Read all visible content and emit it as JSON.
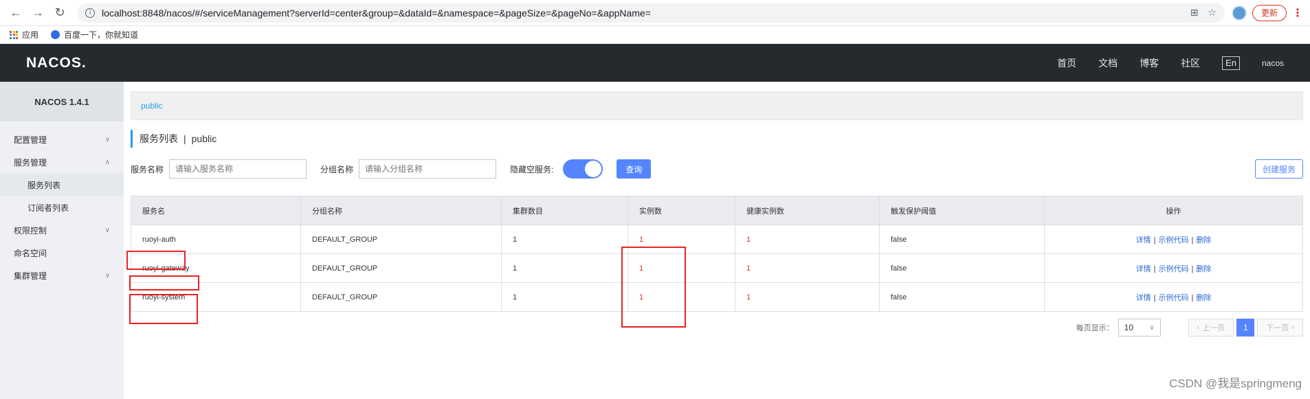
{
  "browser": {
    "url": "localhost:8848/nacos/#/serviceManagement?serverId=center&group=&dataId=&namespace=&pageSize=&pageNo=&appName=",
    "update_label": "更新",
    "bookmarks": [
      "应用",
      "百度一下，你就知道"
    ]
  },
  "header": {
    "logo": "NACOS.",
    "nav": [
      "首页",
      "文档",
      "博客",
      "社区"
    ],
    "lang": "En",
    "user": "nacos"
  },
  "sidebar": {
    "version": "NACOS 1.4.1",
    "items": [
      {
        "label": "配置管理"
      },
      {
        "label": "服务管理"
      },
      {
        "label": "服务列表"
      },
      {
        "label": "订阅者列表"
      },
      {
        "label": "权限控制"
      },
      {
        "label": "命名空间"
      },
      {
        "label": "集群管理"
      }
    ]
  },
  "main": {
    "namespace": "public",
    "title": "服务列表",
    "title_sep": "|",
    "title_ns": "public",
    "filters": {
      "service_label": "服务名称",
      "service_placeholder": "请输入服务名称",
      "group_label": "分组名称",
      "group_placeholder": "请输入分组名称",
      "hide_empty_label": "隐藏空服务:",
      "query_label": "查询",
      "create_label": "创建服务"
    },
    "table": {
      "headers": [
        "服务名",
        "分组名称",
        "集群数目",
        "实例数",
        "健康实例数",
        "触发保护阈值",
        "操作"
      ],
      "rows": [
        {
          "name": "ruoyi-auth",
          "group": "DEFAULT_GROUP",
          "clusters": "1",
          "instances": "1",
          "healthy": "1",
          "threshold": "false"
        },
        {
          "name": "ruoyi-gateway",
          "group": "DEFAULT_GROUP",
          "clusters": "1",
          "instances": "1",
          "healthy": "1",
          "threshold": "false"
        },
        {
          "name": "ruoyi-system",
          "group": "DEFAULT_GROUP",
          "clusters": "1",
          "instances": "1",
          "healthy": "1",
          "threshold": "false"
        }
      ],
      "ops": {
        "detail": "详情",
        "sample": "示例代码",
        "delete": "删除",
        "sep": "|"
      }
    },
    "pager": {
      "per_page_label": "每页显示：",
      "page_size": "10",
      "prev": "上一页",
      "current": "1",
      "next": "下一页"
    }
  },
  "watermark": "CSDN @我是springmeng"
}
